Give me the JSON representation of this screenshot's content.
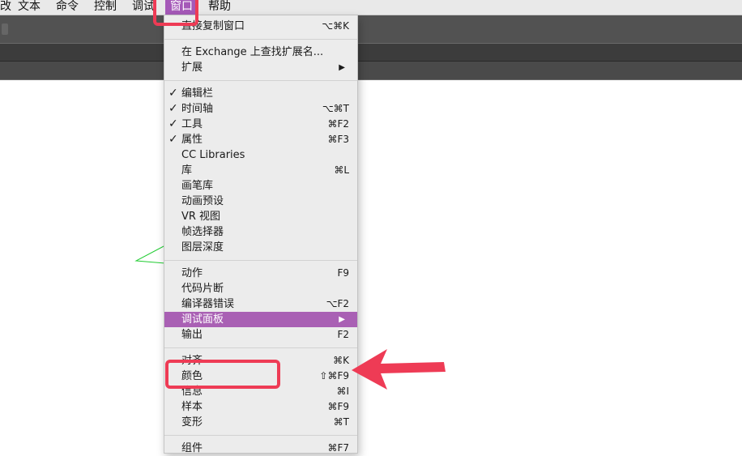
{
  "menubar": {
    "items": [
      "改",
      "文本",
      "命令",
      "控制",
      "调试",
      "窗口",
      "帮助"
    ],
    "active_index": 5,
    "accent": "#a559b8"
  },
  "window_menu": {
    "sections": [
      [
        {
          "label": "直接复制窗口",
          "shortcut": "⌥⌘K",
          "checked": false,
          "submenu": false
        }
      ],
      [
        {
          "label": "在 Exchange 上查找扩展名...",
          "shortcut": "",
          "checked": false,
          "submenu": false
        },
        {
          "label": "扩展",
          "shortcut": "",
          "checked": false,
          "submenu": true
        }
      ],
      [
        {
          "label": "编辑栏",
          "shortcut": "",
          "checked": true,
          "submenu": false
        },
        {
          "label": "时间轴",
          "shortcut": "⌥⌘T",
          "checked": true,
          "submenu": false
        },
        {
          "label": "工具",
          "shortcut": "⌘F2",
          "checked": true,
          "submenu": false
        },
        {
          "label": "属性",
          "shortcut": "⌘F3",
          "checked": true,
          "submenu": false
        },
        {
          "label": "CC Libraries",
          "shortcut": "",
          "checked": false,
          "submenu": false
        },
        {
          "label": "库",
          "shortcut": "⌘L",
          "checked": false,
          "submenu": false
        },
        {
          "label": "画笔库",
          "shortcut": "",
          "checked": false,
          "submenu": false
        },
        {
          "label": "动画预设",
          "shortcut": "",
          "checked": false,
          "submenu": false
        },
        {
          "label": "VR 视图",
          "shortcut": "",
          "checked": false,
          "submenu": false
        },
        {
          "label": "帧选择器",
          "shortcut": "",
          "checked": false,
          "submenu": false
        },
        {
          "label": "图层深度",
          "shortcut": "",
          "checked": false,
          "submenu": false
        }
      ],
      [
        {
          "label": "动作",
          "shortcut": "F9",
          "checked": false,
          "submenu": false
        },
        {
          "label": "代码片断",
          "shortcut": "",
          "checked": false,
          "submenu": false
        },
        {
          "label": "编译器错误",
          "shortcut": "⌥F2",
          "checked": false,
          "submenu": false
        },
        {
          "label": "调试面板",
          "shortcut": "",
          "checked": false,
          "submenu": true,
          "highlighted": true
        },
        {
          "label": "输出",
          "shortcut": "F2",
          "checked": false,
          "submenu": false
        }
      ],
      [
        {
          "label": "对齐",
          "shortcut": "⌘K",
          "checked": false,
          "submenu": false
        },
        {
          "label": "颜色",
          "shortcut": "⇧⌘F9",
          "checked": false,
          "submenu": false
        },
        {
          "label": "信息",
          "shortcut": "⌘I",
          "checked": false,
          "submenu": false
        },
        {
          "label": "样本",
          "shortcut": "⌘F9",
          "checked": false,
          "submenu": false
        },
        {
          "label": "变形",
          "shortcut": "⌘T",
          "checked": false,
          "submenu": false
        }
      ],
      [
        {
          "label": "组件",
          "shortcut": "⌘F7",
          "checked": false,
          "submenu": false
        }
      ]
    ],
    "highlight_color": "#a960b4"
  },
  "annotation": {
    "color": "#ee3b55"
  },
  "icons": {
    "check": "checkmark-icon",
    "submenu": "submenu-arrow-icon"
  }
}
